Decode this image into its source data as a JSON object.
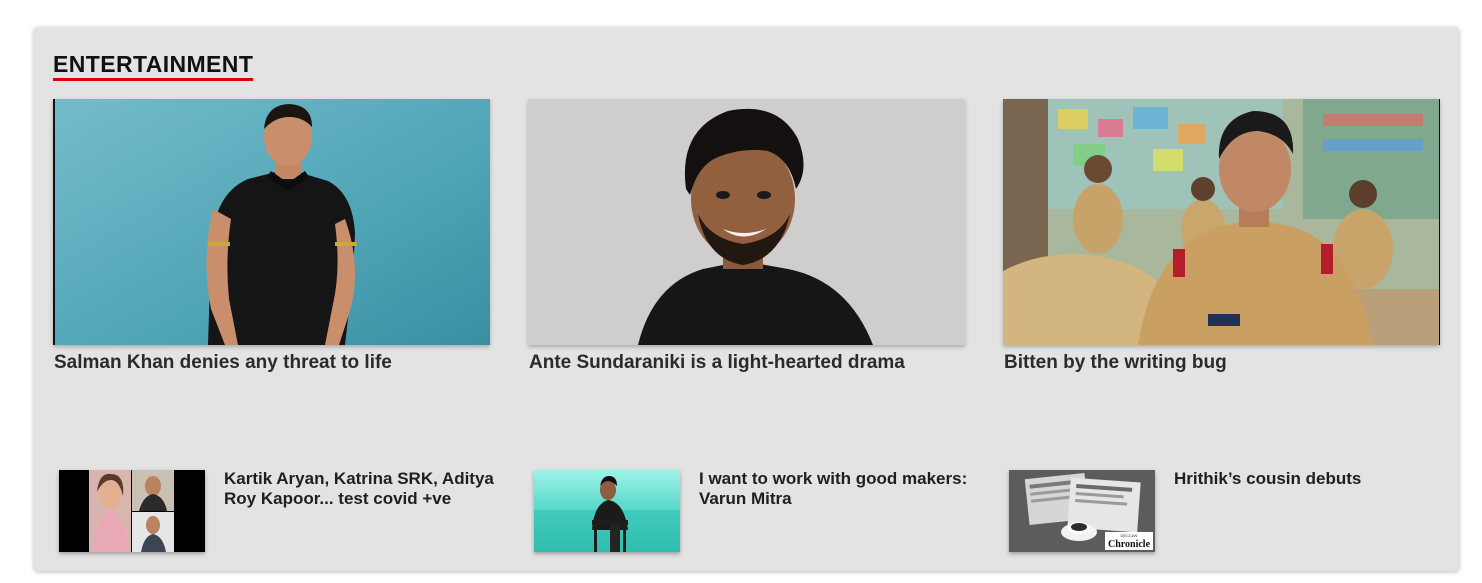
{
  "section": {
    "title": "ENTERTAINMENT",
    "accent_color": "#d8000b"
  },
  "featured": [
    {
      "headline": "Salman Khan denies any threat to life",
      "image_desc": "man-in-black-polo-photo"
    },
    {
      "headline": "Ante Sundaraniki is a light-hearted drama",
      "image_desc": "smiling-man-portrait-photo"
    },
    {
      "headline": "Bitten by the writing bug",
      "image_desc": "police-officer-film-still-photo"
    }
  ],
  "secondary": [
    {
      "headline": "Kartik Aryan, Katrina SRK, Aditya Roy Kapoor... test covid +ve",
      "image_desc": "celebrity-collage-photo"
    },
    {
      "headline": "I want to work with good makers: Varun Mitra",
      "image_desc": "man-on-chair-by-sea-photo"
    },
    {
      "headline": "Hrithik’s cousin debuts",
      "image_desc": "newspapers-and-coffee-photo",
      "logo_text": "Chronicle",
      "logo_small_text": "DECCAN"
    }
  ]
}
